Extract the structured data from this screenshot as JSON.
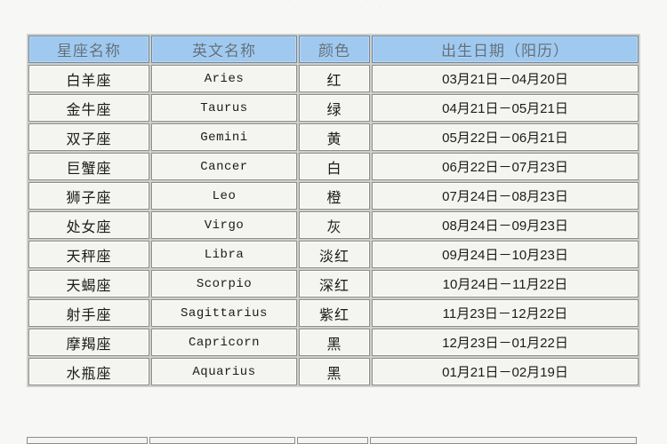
{
  "page": {
    "background_color": "#f7f7f5",
    "ghost_caption": "· · · · ·   · ·   · · · ·"
  },
  "table": {
    "header_background": "#9fc9ef",
    "header_text_color": "#5f6f7f",
    "cell_background": "#f4f4f0",
    "border_color": "#8d8d8d",
    "columns": [
      {
        "key": "name",
        "label": "星座名称"
      },
      {
        "key": "en",
        "label": "英文名称"
      },
      {
        "key": "color",
        "label": "颜色"
      },
      {
        "key": "date",
        "label": "出生日期（阳历）"
      }
    ],
    "rows": [
      {
        "name": "白羊座",
        "en": "Aries",
        "color": "红",
        "date": "03月21日－04月20日"
      },
      {
        "name": "金牛座",
        "en": "Taurus",
        "color": "绿",
        "date": "04月21日－05月21日"
      },
      {
        "name": "双子座",
        "en": "Gemini",
        "color": "黄",
        "date": "05月22日－06月21日"
      },
      {
        "name": "巨蟹座",
        "en": "Cancer",
        "color": "白",
        "date": "06月22日－07月23日"
      },
      {
        "name": "狮子座",
        "en": "Leo",
        "color": "橙",
        "date": "07月24日－08月23日"
      },
      {
        "name": "处女座",
        "en": "Virgo",
        "color": "灰",
        "date": "08月24日－09月23日"
      },
      {
        "name": "天秤座",
        "en": "Libra",
        "color": "淡红",
        "date": "09月24日－10月23日"
      },
      {
        "name": "天蝎座",
        "en": "Scorpio",
        "color": "深红",
        "date": "10月24日－11月22日"
      },
      {
        "name": "射手座",
        "en": "Sagittarius",
        "color": "紫红",
        "date": "11月23日－12月22日"
      },
      {
        "name": "摩羯座",
        "en": "Capricorn",
        "color": "黑",
        "date": "12月23日－01月22日"
      },
      {
        "name": "水瓶座",
        "en": "Aquarius",
        "color": "黑",
        "date": "01月21日－02月19日"
      }
    ]
  }
}
